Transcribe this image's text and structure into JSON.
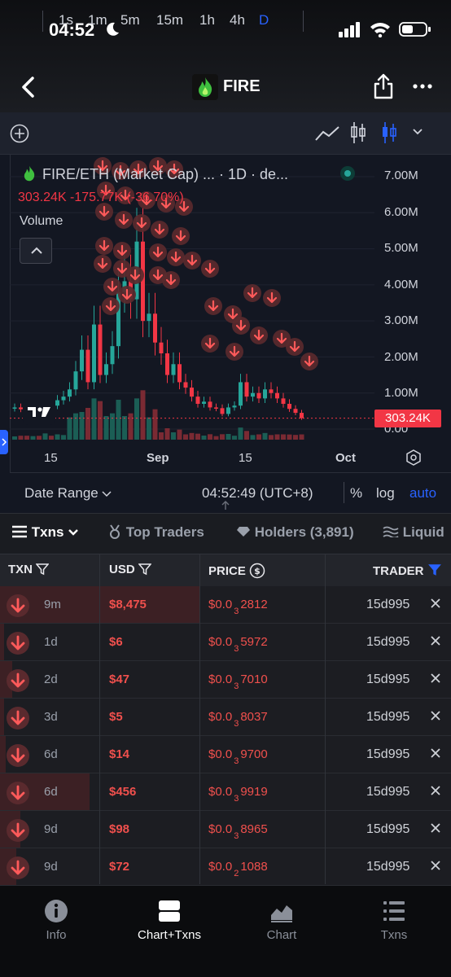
{
  "status_bar": {
    "time": "04:52"
  },
  "header": {
    "title": "FIRE"
  },
  "toolbar": {
    "intervals": [
      "1s",
      "1m",
      "5m",
      "15m",
      "1h",
      "4h",
      "D"
    ],
    "active_interval": "D"
  },
  "chart": {
    "pair_title": "FIRE/ETH (Market Cap) ... · 1D · de...",
    "price_change": "303.24K -175.77K (-36.70%)",
    "volume_label": "Volume",
    "y_labels": [
      "7.00M",
      "6.00M",
      "5.00M",
      "4.00M",
      "3.00M",
      "2.00M",
      "1.00M",
      "0.00"
    ],
    "current_price_tag": "303.24K",
    "x_labels": [
      "15",
      "Sep",
      "15",
      "Oct"
    ]
  },
  "chart_data": {
    "type": "candlestick",
    "title": "FIRE/ETH (Market Cap) ... · 1D · de...",
    "ylabel": "",
    "ylim": [
      0,
      7000000
    ],
    "y_ticks": [
      "7.00M",
      "6.00M",
      "5.00M",
      "4.00M",
      "3.00M",
      "2.00M",
      "1.00M",
      "0.00"
    ],
    "x_ticks": [
      "15",
      "Sep",
      "15",
      "Oct"
    ],
    "last_value": 303240,
    "change": -175770,
    "change_percent": -36.7,
    "closes": [
      600000,
      550000,
      500000,
      520000,
      480000,
      700000,
      650000,
      800000,
      900000,
      1100000,
      1600000,
      2200000,
      1300000,
      2900000,
      1500000,
      1800000,
      2300000,
      3800000,
      4100000,
      3600000,
      5200000,
      3000000,
      3200000,
      2400000,
      2100000,
      1500000,
      1800000,
      1300000,
      1150000,
      900000,
      700000,
      760000,
      600000,
      580000,
      420000,
      600000,
      650000,
      1300000,
      900000,
      1000000,
      850000,
      1100000,
      1000000,
      850000,
      700000,
      560000,
      450000,
      303240
    ],
    "grid": true,
    "legend": "none"
  },
  "range_bar": {
    "date_range": "Date Range",
    "time": "04:52:49 (UTC+8)",
    "percent": "%",
    "log": "log",
    "auto": "auto"
  },
  "tabs": [
    "Txns",
    "Top Traders",
    "Holders (3,891)",
    "Liquid"
  ],
  "table": {
    "headers": {
      "txn": "TXN",
      "usd": "USD",
      "price": "PRICE",
      "trader": "TRADER"
    },
    "rows": [
      {
        "age": "9m",
        "usd": "$8,475",
        "price_prefix": "$0.0",
        "price_sub": "3",
        "price_digits": "2812",
        "trader": "15d995",
        "tint": 1.0
      },
      {
        "age": "1d",
        "usd": "$6",
        "price_prefix": "$0.0",
        "price_sub": "3",
        "price_digits": "5972",
        "trader": "15d995",
        "tint": 0.02
      },
      {
        "age": "2d",
        "usd": "$47",
        "price_prefix": "$0.0",
        "price_sub": "3",
        "price_digits": "7010",
        "trader": "15d995",
        "tint": 0.06
      },
      {
        "age": "3d",
        "usd": "$5",
        "price_prefix": "$0.0",
        "price_sub": "3",
        "price_digits": "8037",
        "trader": "15d995",
        "tint": 0.02
      },
      {
        "age": "6d",
        "usd": "$14",
        "price_prefix": "$0.0",
        "price_sub": "3",
        "price_digits": "9700",
        "trader": "15d995",
        "tint": 0.03
      },
      {
        "age": "6d",
        "usd": "$456",
        "price_prefix": "$0.0",
        "price_sub": "3",
        "price_digits": "9919",
        "trader": "15d995",
        "tint": 0.45
      },
      {
        "age": "9d",
        "usd": "$98",
        "price_prefix": "$0.0",
        "price_sub": "3",
        "price_digits": "8965",
        "trader": "15d995",
        "tint": 0.1
      },
      {
        "age": "9d",
        "usd": "$72",
        "price_prefix": "$0.0",
        "price_sub": "2",
        "price_digits": "1088",
        "trader": "15d995",
        "tint": 0.08
      }
    ]
  },
  "bottom_nav": {
    "items": [
      "Info",
      "Chart+Txns",
      "Chart",
      "Txns"
    ],
    "active": "Chart+Txns"
  },
  "colors": {
    "accent": "#2962ff",
    "down": "#f23645",
    "up": "#26a69a",
    "background": "#131722"
  }
}
